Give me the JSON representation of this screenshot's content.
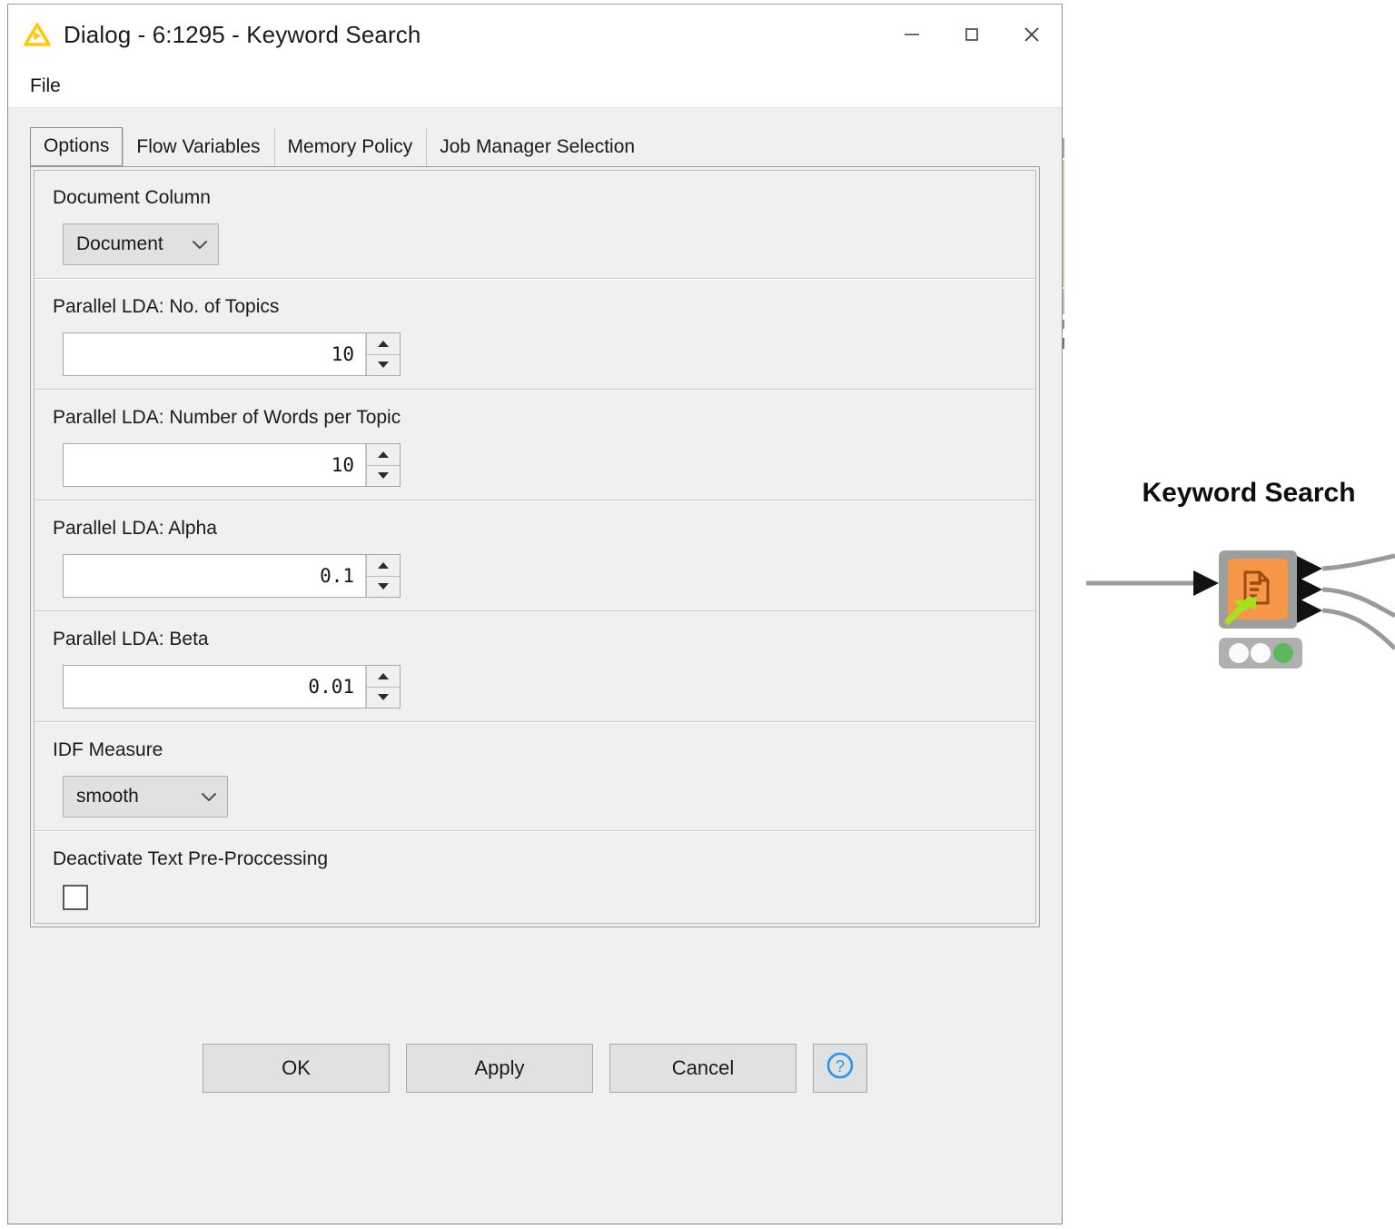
{
  "window": {
    "title": "Dialog - 6:1295 - Keyword Search",
    "app_icon": "knime-triangle-icon",
    "minimize_label": "Minimize",
    "maximize_label": "Maximize",
    "close_label": "Close"
  },
  "menubar": {
    "items": [
      {
        "label": "File",
        "name": "menu-file"
      }
    ]
  },
  "tabs": [
    {
      "label": "Options",
      "name": "tab-options",
      "selected": true
    },
    {
      "label": "Flow Variables",
      "name": "tab-flow-variables",
      "selected": false
    },
    {
      "label": "Memory Policy",
      "name": "tab-memory-policy",
      "selected": false
    },
    {
      "label": "Job Manager Selection",
      "name": "tab-job-manager-selection",
      "selected": false
    }
  ],
  "options": {
    "document_column": {
      "label": "Document Column",
      "value": "Document",
      "control": "combobox"
    },
    "no_of_topics": {
      "label": "Parallel LDA: No. of Topics",
      "value": "10",
      "control": "spinner"
    },
    "words_per_topic": {
      "label": "Parallel LDA: Number of Words per Topic",
      "value": "10",
      "control": "spinner"
    },
    "alpha": {
      "label": "Parallel LDA: Alpha",
      "value": "0.1",
      "control": "spinner"
    },
    "beta": {
      "label": "Parallel LDA: Beta",
      "value": "0.01",
      "control": "spinner"
    },
    "idf_measure": {
      "label": "IDF Measure",
      "value": "smooth",
      "control": "combobox"
    },
    "deactivate_preprocessing": {
      "label": "Deactivate Text Pre-Proccessing",
      "checked": false,
      "control": "checkbox"
    }
  },
  "footer": {
    "ok": "OK",
    "apply": "Apply",
    "cancel": "Cancel",
    "help": "?"
  },
  "canvas_node": {
    "title": "Keyword Search",
    "icon": "document-icon",
    "status": "executed",
    "input_ports": 1,
    "output_ports": 3,
    "traffic_light": [
      "idle",
      "idle",
      "green"
    ]
  },
  "colors": {
    "node_orange": "#F79646",
    "node_frame": "#9E9E9E",
    "status_green": "#5CB85C",
    "knime_yellow": "#FFD200",
    "dialog_bg": "#F0F0F0",
    "help_blue": "#2196F3"
  }
}
